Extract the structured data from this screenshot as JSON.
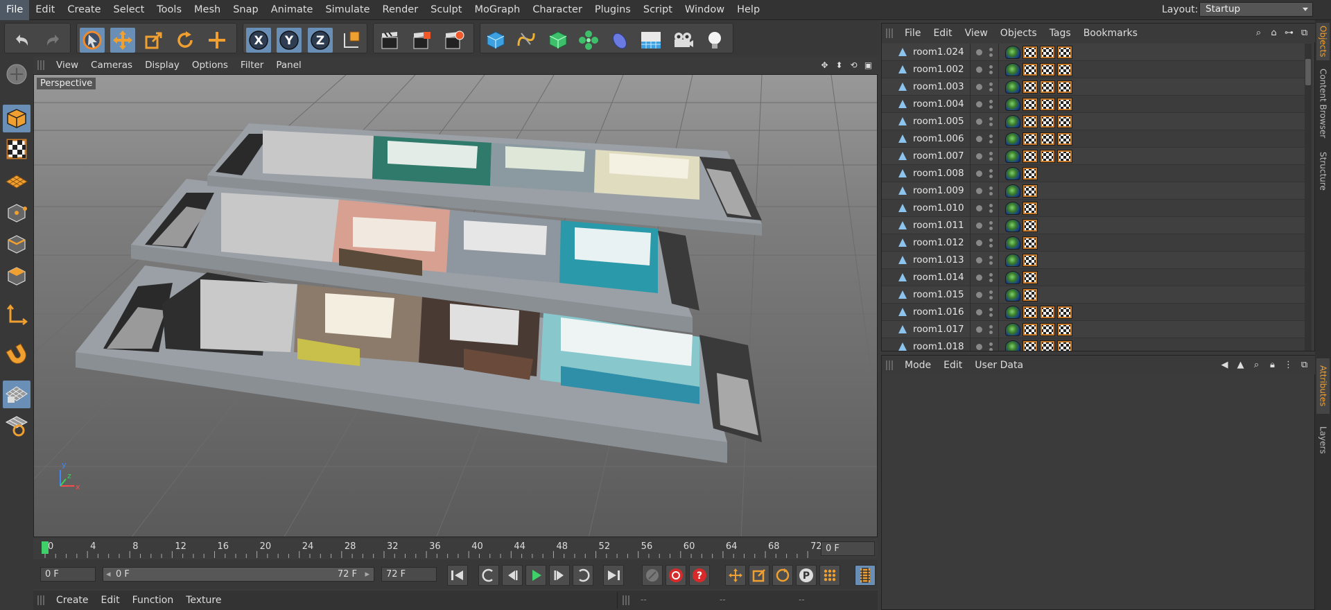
{
  "menubar": {
    "items": [
      "File",
      "Edit",
      "Create",
      "Select",
      "Tools",
      "Mesh",
      "Snap",
      "Animate",
      "Simulate",
      "Render",
      "Sculpt",
      "MoGraph",
      "Character",
      "Plugins",
      "Script",
      "Window",
      "Help"
    ],
    "layout_label": "Layout:",
    "layout_value": "Startup"
  },
  "toolbar": {
    "icons": [
      "undo-icon",
      "redo-icon",
      "live-selection-icon",
      "move-icon",
      "scale-icon",
      "rotate-icon",
      "recent-tool-icon",
      "x-axis-icon",
      "y-axis-icon",
      "z-axis-icon",
      "coordinate-system-icon",
      "render-view-icon",
      "render-picture-viewer-icon",
      "edit-render-settings-icon",
      "cube-icon",
      "pen-spline-icon",
      "subdivision-icon",
      "array-icon",
      "deformer-icon",
      "floor-icon",
      "camera-icon",
      "light-icon"
    ],
    "axis_labels": {
      "x": "X",
      "y": "Y",
      "z": "Z"
    }
  },
  "left_toolbar": {
    "icons": [
      "make-editable-icon",
      "model-mode-icon",
      "texture-mode-icon",
      "workplane-icon",
      "points-mode-icon",
      "edges-mode-icon",
      "polygons-mode-icon",
      "axis-mode-icon",
      "magnet-icon",
      "snap-icon",
      "lock-workplane-icon"
    ]
  },
  "viewport": {
    "menu": [
      "View",
      "Cameras",
      "Display",
      "Options",
      "Filter",
      "Panel"
    ],
    "camera_label": "Perspective",
    "axes": {
      "x": "x",
      "y": "y",
      "z": "z"
    }
  },
  "timeline": {
    "ticks": [
      "0",
      "4",
      "8",
      "12",
      "16",
      "20",
      "24",
      "28",
      "32",
      "36",
      "40",
      "44",
      "48",
      "52",
      "56",
      "60",
      "64",
      "68",
      "72"
    ],
    "current_frame_field": "0 F"
  },
  "controls": {
    "start_field": "0 F",
    "range_start": "0 F",
    "range_end": "72 F",
    "end_field": "72 F"
  },
  "material_manager": {
    "menu": [
      "Create",
      "Edit",
      "Function",
      "Texture"
    ],
    "coord_placeholders": [
      "--",
      "--",
      "--"
    ]
  },
  "objects_panel": {
    "menu": [
      "File",
      "Edit",
      "View",
      "Objects",
      "Tags",
      "Bookmarks"
    ],
    "rows": [
      {
        "name": "room1.024",
        "materials": 3
      },
      {
        "name": "room1.002",
        "materials": 3
      },
      {
        "name": "room1.003",
        "materials": 3
      },
      {
        "name": "room1.004",
        "materials": 3
      },
      {
        "name": "room1.005",
        "materials": 3
      },
      {
        "name": "room1.006",
        "materials": 3
      },
      {
        "name": "room1.007",
        "materials": 3
      },
      {
        "name": "room1.008",
        "materials": 1
      },
      {
        "name": "room1.009",
        "materials": 1
      },
      {
        "name": "room1.010",
        "materials": 1
      },
      {
        "name": "room1.011",
        "materials": 1
      },
      {
        "name": "room1.012",
        "materials": 1
      },
      {
        "name": "room1.013",
        "materials": 1
      },
      {
        "name": "room1.014",
        "materials": 1
      },
      {
        "name": "room1.015",
        "materials": 1
      },
      {
        "name": "room1.016",
        "materials": 3
      },
      {
        "name": "room1.017",
        "materials": 3
      },
      {
        "name": "room1.018",
        "materials": 3
      }
    ]
  },
  "attributes_panel": {
    "menu": [
      "Mode",
      "Edit",
      "User Data"
    ]
  },
  "side_tabs": [
    "Objects",
    "Content Browser",
    "Structure",
    "Attributes",
    "Layers"
  ],
  "colors": {
    "accent": "#6a8fb6",
    "active_tab": "#f0a030",
    "playhead": "#3fd06a"
  }
}
